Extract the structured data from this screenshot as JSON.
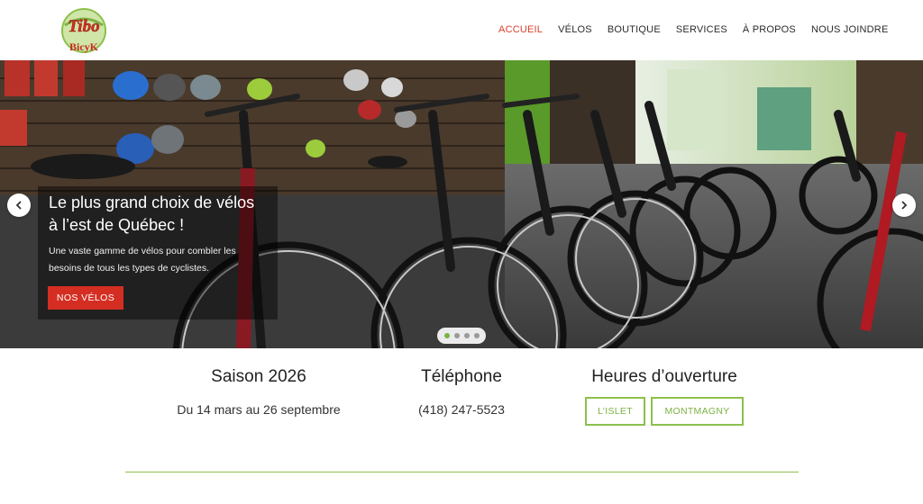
{
  "brand": {
    "logo_line1": "Tibo",
    "logo_line2": "BicyK"
  },
  "nav": {
    "items": [
      {
        "label": "ACCUEIL",
        "active": true
      },
      {
        "label": "VÉLOS",
        "active": false
      },
      {
        "label": "BOUTIQUE",
        "active": false
      },
      {
        "label": "SERVICES",
        "active": false
      },
      {
        "label": "À PROPOS",
        "active": false
      },
      {
        "label": "NOUS JOINDRE",
        "active": false
      }
    ]
  },
  "hero": {
    "title_line1": "Le plus grand choix de vélos",
    "title_line2": "à l’est de Québec !",
    "text_line1": "Une vaste gamme de vélos pour combler les",
    "text_line2": "besoins de tous les types de cyclistes.",
    "button_label": "NOS VÉLOS",
    "slide_count": 4,
    "active_slide": 1
  },
  "info": {
    "season_title": "Saison 2026",
    "season_dates": "Du 14 mars au 26 septembre",
    "phone_title": "Téléphone",
    "phone_number": "(418) 247-5523",
    "hours_title": "Heures d’ouverture",
    "hours_buttons": [
      "L’ISLET",
      "MONTMAGNY"
    ]
  },
  "colors": {
    "accent_red": "#d42e22",
    "accent_green": "#8dc04b",
    "nav_active": "#d9402c"
  }
}
